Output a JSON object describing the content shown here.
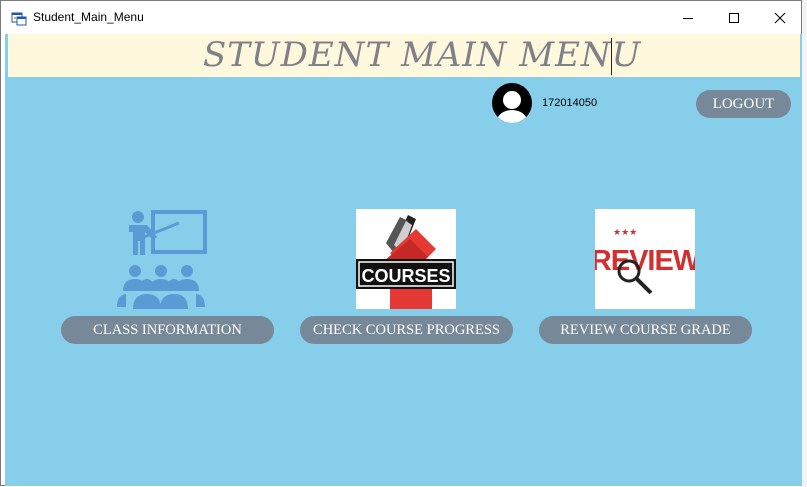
{
  "window": {
    "title": "Student_Main_Menu",
    "icon": "winforms-app-icon"
  },
  "header": {
    "title": "STUDENT MAIN MENU"
  },
  "user": {
    "avatar_icon": "user-avatar-icon",
    "id": "172014050"
  },
  "logout": {
    "label": "LOGOUT"
  },
  "menu": {
    "class_information": {
      "label": "CLASS INFORMATION",
      "icon": "classroom-teacher-icon"
    },
    "check_course_progress": {
      "label": "CHECK COURSE PROGRESS",
      "icon": "courses-books-image",
      "image_text": "COURSES"
    },
    "review_course_grade": {
      "label": "REVIEW COURSE GRADE",
      "icon": "review-magnifier-image",
      "image_text": "REVIEW"
    }
  },
  "colors": {
    "client_bg": "#87ceeb",
    "header_bg": "#fff8dc",
    "button_bg": "#778899",
    "button_text": "#ffffff"
  }
}
